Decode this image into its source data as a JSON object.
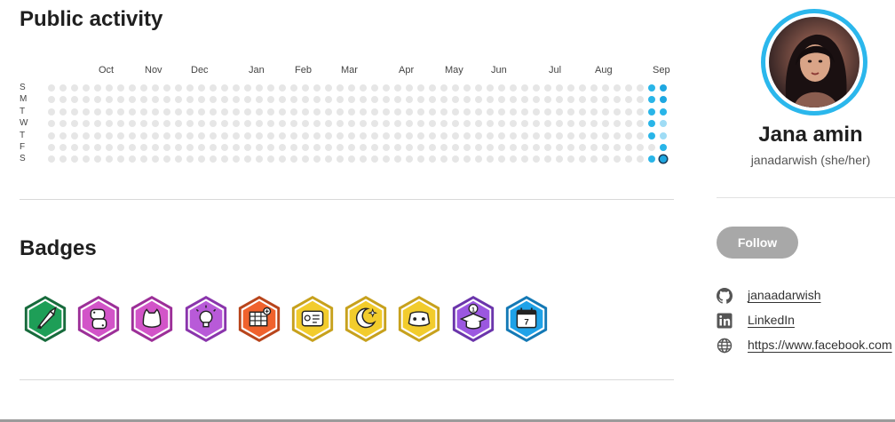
{
  "activity": {
    "title": "Public activity",
    "months": [
      "Oct",
      "Nov",
      "Dec",
      "Jan",
      "Feb",
      "Mar",
      "Apr",
      "May",
      "Jun",
      "Jul",
      "Aug",
      "Sep"
    ],
    "days": [
      "S",
      "M",
      "T",
      "W",
      "T",
      "F",
      "S"
    ],
    "weeks": 54,
    "active": [
      {
        "week": 52,
        "day": 0,
        "level": 2
      },
      {
        "week": 53,
        "day": 0,
        "level": 3
      },
      {
        "week": 52,
        "day": 1,
        "level": 2
      },
      {
        "week": 53,
        "day": 1,
        "level": 3
      },
      {
        "week": 52,
        "day": 2,
        "level": 2
      },
      {
        "week": 53,
        "day": 2,
        "level": 2
      },
      {
        "week": 52,
        "day": 3,
        "level": 2
      },
      {
        "week": 53,
        "day": 3,
        "level": 1
      },
      {
        "week": 52,
        "day": 4,
        "level": 2
      },
      {
        "week": 53,
        "day": 4,
        "level": 1
      },
      {
        "week": 53,
        "day": 5,
        "level": 2
      },
      {
        "week": 52,
        "day": 6,
        "level": 2
      },
      {
        "week": 53,
        "day": 6,
        "level": 3,
        "today": true
      }
    ],
    "colors": {
      "empty": "#e6e6e6",
      "active": "#1ea7e1"
    }
  },
  "badges": {
    "title": "Badges",
    "items": [
      {
        "icon": "rocket-icon",
        "color": "#1e9e57",
        "dark": "#176b3c"
      },
      {
        "icon": "python-icon",
        "color": "#d254c8",
        "dark": "#9c2f98"
      },
      {
        "icon": "github-cat-icon",
        "color": "#d254c8",
        "dark": "#9c2f98"
      },
      {
        "icon": "lightbulb-icon",
        "color": "#b85ad8",
        "dark": "#8a35ac"
      },
      {
        "icon": "spreadsheet-icon",
        "color": "#f0622d",
        "dark": "#b8451c"
      },
      {
        "icon": "id-card-icon",
        "color": "#f2cc2c",
        "dark": "#c7a11d"
      },
      {
        "icon": "moon-icon",
        "color": "#f2cc2c",
        "dark": "#c7a11d"
      },
      {
        "icon": "discord-icon",
        "color": "#f2cc2c",
        "dark": "#c7a11d"
      },
      {
        "icon": "graduation-cap-icon",
        "color": "#9b57e0",
        "dark": "#6b35ab"
      },
      {
        "icon": "calendar-icon",
        "color": "#1fa2e8",
        "dark": "#1479b5"
      }
    ],
    "calendar_day": "7",
    "cap_number": "1"
  },
  "profile": {
    "name": "Jana amin",
    "handle": "janadarwish (she/her)",
    "follow_label": "Follow",
    "accent": "#2bb7ec",
    "links": [
      {
        "icon": "github-icon",
        "text": "janaadarwish"
      },
      {
        "icon": "linkedin-icon",
        "text": "LinkedIn"
      },
      {
        "icon": "globe-icon",
        "text": "https://www.facebook.com"
      }
    ]
  }
}
